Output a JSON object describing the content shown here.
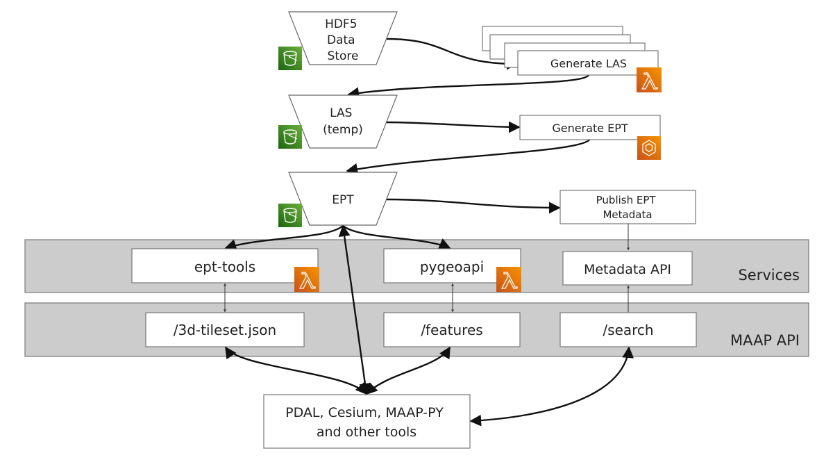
{
  "stores": [
    {
      "id": "hdf5",
      "lines": [
        "HDF5",
        "Data",
        "Store"
      ],
      "icon": "s3-bucket-icon"
    },
    {
      "id": "las",
      "lines": [
        "LAS",
        "(temp)"
      ],
      "icon": "s3-bucket-icon"
    },
    {
      "id": "ept",
      "lines": [
        "EPT"
      ],
      "icon": "s3-bucket-icon"
    }
  ],
  "processes": {
    "generate_las": {
      "label": "Generate LAS",
      "icon": "lambda-icon",
      "stacked": true
    },
    "generate_ept": {
      "label": "Generate EPT",
      "icon": "batch-compute-icon"
    },
    "publish": {
      "lines": [
        "Publish EPT",
        "Metadata"
      ]
    }
  },
  "bands": {
    "services": {
      "label": "Services"
    },
    "maap_api": {
      "label": "MAAP API"
    }
  },
  "services": [
    {
      "label": "ept-tools",
      "icon": "lambda-icon"
    },
    {
      "label": "pygeoapi",
      "icon": "lambda-icon"
    },
    {
      "label": "Metadata API"
    }
  ],
  "endpoints": [
    {
      "label": "/3d-tileset.json"
    },
    {
      "label": "/features"
    },
    {
      "label": "/search"
    }
  ],
  "clients": {
    "lines": [
      "PDAL, Cesium, MAAP-PY",
      "and other tools"
    ]
  },
  "colors": {
    "s3_green": "#3f8624",
    "lambda_orange": "#e4731b",
    "band_gray": "#cccccc"
  }
}
